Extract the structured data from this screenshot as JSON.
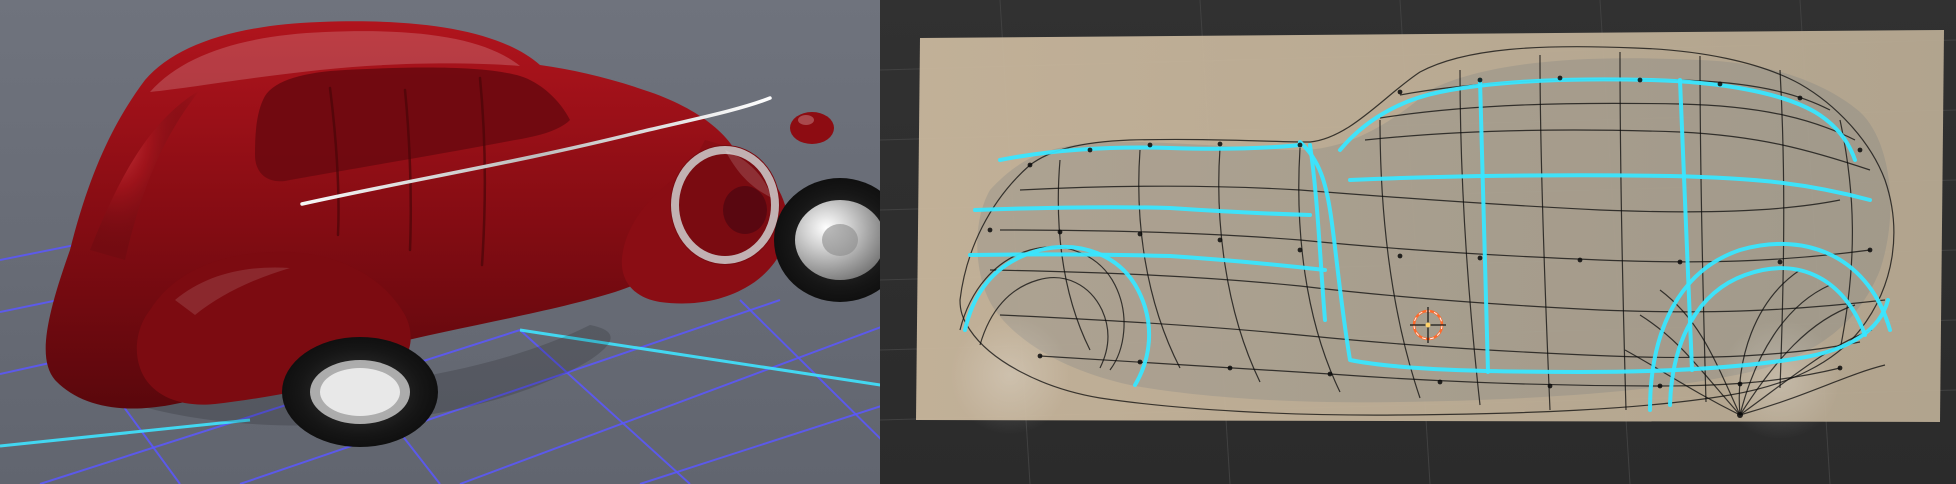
{
  "scene": {
    "left_viewport": {
      "mode": "render",
      "background": "#6b6f79",
      "grid_color": "#5a57ff",
      "axis_color": "#3fe3ff",
      "car_color": "#8a0d14",
      "chrome_color": "#cfcfcf"
    },
    "right_viewport": {
      "mode": "edit-mesh",
      "background": "#2f2f2f",
      "reference_background": "#c8b79c",
      "wire_color": "#0b0b0b",
      "edge_loop_color": "#39e6ff",
      "cursor_color": "#ff6a2b"
    }
  }
}
